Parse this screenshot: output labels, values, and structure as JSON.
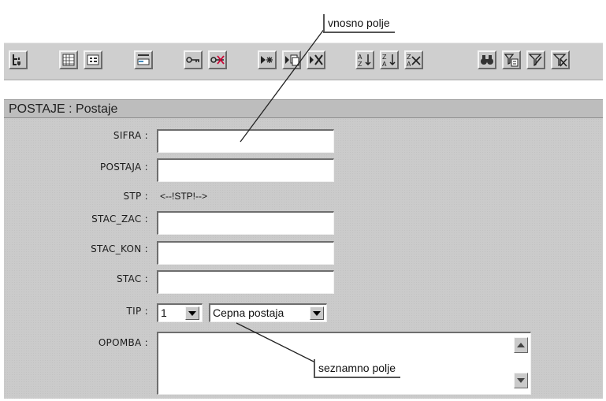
{
  "callouts": {
    "input_field": "vnosno polje",
    "list_field": "seznamno polje"
  },
  "toolbar": {
    "buttons": [
      {
        "name": "hierarchy-icon"
      },
      {
        "name": "grid-view-icon"
      },
      {
        "name": "form-view-icon"
      },
      {
        "name": "field-edit-icon"
      },
      {
        "name": "key-icon"
      },
      {
        "name": "key-remove-icon"
      },
      {
        "name": "insert-record-icon"
      },
      {
        "name": "copy-record-icon"
      },
      {
        "name": "delete-record-icon"
      },
      {
        "name": "sort-ascending-icon"
      },
      {
        "name": "sort-descending-icon"
      },
      {
        "name": "clear-sort-icon"
      },
      {
        "name": "search-binoculars-icon"
      },
      {
        "name": "filter-form-icon"
      },
      {
        "name": "filter-apply-icon"
      },
      {
        "name": "filter-remove-icon"
      }
    ]
  },
  "form": {
    "title": "POSTAJE : Postaje",
    "fields": {
      "sifra": {
        "label": "SIFRA :",
        "value": ""
      },
      "postaja": {
        "label": "POSTAJA :",
        "value": ""
      },
      "stp": {
        "label": "STP :",
        "value": "<--!STP!-->"
      },
      "stac_zac": {
        "label": "STAC_ZAC :",
        "value": ""
      },
      "stac_kon": {
        "label": "STAC_KON :",
        "value": ""
      },
      "stac": {
        "label": "STAC :",
        "value": ""
      },
      "tip": {
        "label": "TIP :",
        "code": "1",
        "text": "Cepna postaja"
      },
      "opomba": {
        "label": "OPOMBA :",
        "value": ""
      }
    }
  }
}
